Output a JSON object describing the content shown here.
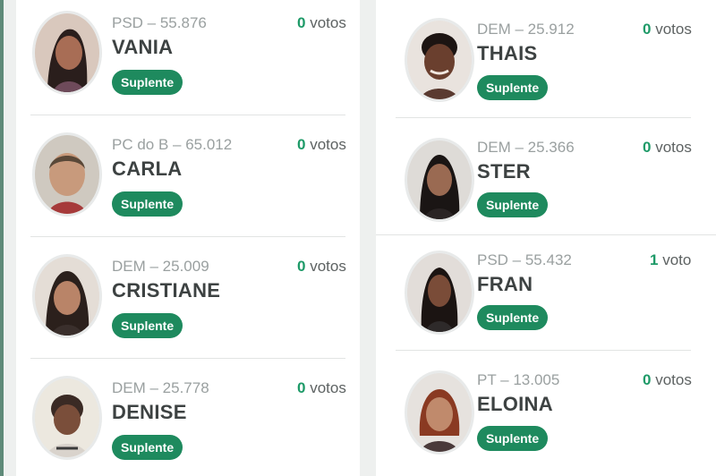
{
  "candidates_left": [
    {
      "party": "PSD – 55.876",
      "name": "VANIA",
      "status": "Suplente",
      "vote_count": "0",
      "vote_word": "votos",
      "icon": "candidate-photo"
    },
    {
      "party": "PC do B – 65.012",
      "name": "CARLA",
      "status": "Suplente",
      "vote_count": "0",
      "vote_word": "votos",
      "icon": "candidate-photo"
    },
    {
      "party": "DEM – 25.009",
      "name": "CRISTIANE",
      "status": "Suplente",
      "vote_count": "0",
      "vote_word": "votos",
      "icon": "candidate-photo"
    },
    {
      "party": "DEM – 25.778",
      "name": "DENISE",
      "status": "Suplente",
      "vote_count": "0",
      "vote_word": "votos",
      "icon": "candidate-photo"
    }
  ],
  "candidates_right": [
    {
      "party": "DEM – 25.912",
      "name": "THAIS",
      "status": "Suplente",
      "vote_count": "0",
      "vote_word": "votos",
      "icon": "candidate-photo"
    },
    {
      "party": "DEM – 25.366",
      "name": "STER",
      "status": "Suplente",
      "vote_count": "0",
      "vote_word": "votos",
      "icon": "candidate-photo"
    },
    {
      "party": "PSD – 55.432",
      "name": "FRAN",
      "status": "Suplente",
      "vote_count": "1",
      "vote_word": "voto",
      "icon": "candidate-photo"
    },
    {
      "party": "PT – 13.005",
      "name": "ELOINA",
      "status": "Suplente",
      "vote_count": "0",
      "vote_word": "votos",
      "icon": "candidate-photo"
    }
  ],
  "colors": {
    "badge": "#1e8a5e",
    "vote_number": "#1e9a68",
    "party_text": "#9aa0a0",
    "name_text": "#3d4242"
  }
}
